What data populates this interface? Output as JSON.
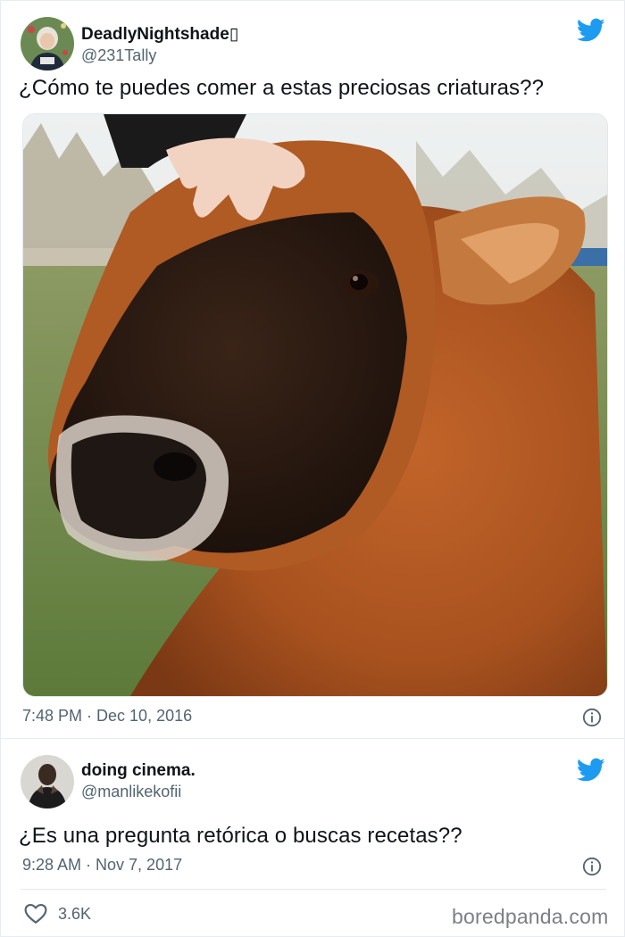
{
  "tweet1": {
    "display_name": "DeadlyNightshade",
    "name_glyph": "▯",
    "handle": "@231Tally",
    "text": "¿Cómo te puedes comer a estas preciosas criaturas??",
    "timestamp": "7:48 PM · Dec 10, 2016",
    "avatar_icon": "avatar-woman-festive",
    "photo": "cow-photo"
  },
  "tweet2": {
    "display_name": "doing cinema.",
    "handle": "@manlikekofii",
    "text": "¿Es una pregunta retórica o buscas recetas??",
    "timestamp": "9:28 AM · Nov 7, 2017",
    "likes": "3.6K",
    "avatar_icon": "avatar-man"
  },
  "watermark": "boredpanda.com",
  "colors": {
    "twitter_blue": "#1d9bf0",
    "secondary_text": "#536471",
    "border": "#e6ecf0"
  }
}
